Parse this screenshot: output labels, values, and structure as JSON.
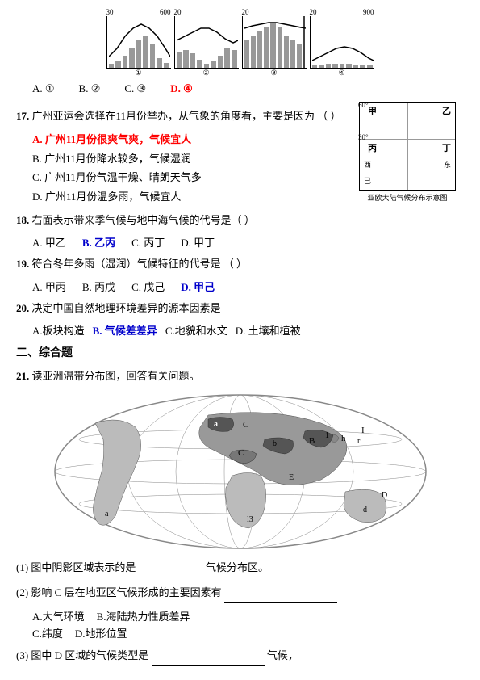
{
  "charts": {
    "note": "Temperature/precipitation charts at top"
  },
  "answerRow1": {
    "options": [
      "A. ①",
      "B. ②",
      "C. ③",
      "D. ④"
    ],
    "selected": "D"
  },
  "q17": {
    "num": "17.",
    "text": "广州亚运会选择在11月份举办，从气象的角度看，主要是因为",
    "bracket": "（  ）",
    "options": [
      {
        "id": "A",
        "text": "广州11月份很爽气爽，气候宜人",
        "correct": true,
        "color": "red"
      },
      {
        "id": "B",
        "text": "广州11月份降水较多，气候湿润"
      },
      {
        "id": "C",
        "text": "广州11月份气温干燥、晴朗天气多"
      },
      {
        "id": "D",
        "text": "广州11月份温多雨，气候宜人"
      }
    ]
  },
  "q18": {
    "num": "18.",
    "text": "右面表示带来季气候与地中海气候的代号是（",
    "bracket": "）",
    "options": [
      {
        "id": "A",
        "text": "甲乙",
        "correct": false
      },
      {
        "id": "B",
        "text": "乙丙",
        "correct": true,
        "color": "blue"
      },
      {
        "id": "C",
        "text": "丙丁"
      },
      {
        "id": "D",
        "text": "甲丁"
      }
    ]
  },
  "q19": {
    "num": "19.",
    "text": "符合冬年多雨（湿润）气候特征的代号是",
    "bracket": "（  ）",
    "options": [
      {
        "id": "A",
        "text": "甲丙"
      },
      {
        "id": "B",
        "text": "丙戊"
      },
      {
        "id": "C",
        "text": "戊己"
      },
      {
        "id": "D",
        "text": "甲己",
        "correct": true,
        "color": "blue"
      }
    ]
  },
  "q20": {
    "num": "20.",
    "text": "决定中国自然地理环境差异的源本因素是",
    "options": [
      "A.板块构造",
      "B. 气候差差异",
      "C.地貌和水文",
      "D. 土壤和植被"
    ],
    "correct": "B",
    "correct_text": "气候差差异"
  },
  "section2": {
    "title": "二、综合题",
    "q21": {
      "num": "21.",
      "intro": "读亚洲温带分布图，回答有关问题。",
      "sub": [
        {
          "num": "(1)",
          "text": "图中阴影区域表示的是",
          "fill": "",
          "suffix": "气候分布区。"
        },
        {
          "num": "(2)",
          "text": "影响 C 层在地亚区气候形成的主要因素有",
          "fill": "",
          "options": [
            "A.大气环境",
            "B.海陆热力性质差异",
            "C.纬度",
            "D.地形位置"
          ]
        },
        {
          "num": "(3)",
          "text": "图中 D 区域的气候类型是",
          "fill": "",
          "suffix": "气候，"
        }
      ]
    }
  },
  "smallMap": {
    "labels": [
      "甲",
      "乙",
      "丙",
      "丁"
    ],
    "latitudes": [
      "60°",
      "30°"
    ],
    "axis_label": "亚欧大陆气候分布示意图"
  }
}
